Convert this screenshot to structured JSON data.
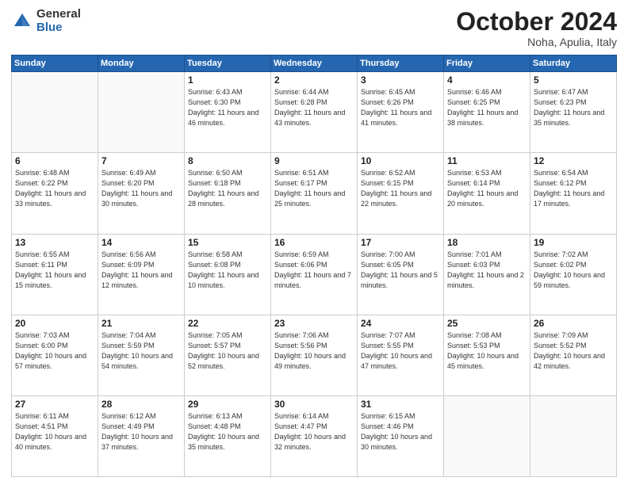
{
  "logo": {
    "general": "General",
    "blue": "Blue"
  },
  "header": {
    "month": "October 2024",
    "location": "Noha, Apulia, Italy"
  },
  "weekdays": [
    "Sunday",
    "Monday",
    "Tuesday",
    "Wednesday",
    "Thursday",
    "Friday",
    "Saturday"
  ],
  "weeks": [
    [
      {
        "day": null,
        "sunrise": "",
        "sunset": "",
        "daylight": ""
      },
      {
        "day": null,
        "sunrise": "",
        "sunset": "",
        "daylight": ""
      },
      {
        "day": "1",
        "sunrise": "Sunrise: 6:43 AM",
        "sunset": "Sunset: 6:30 PM",
        "daylight": "Daylight: 11 hours and 46 minutes."
      },
      {
        "day": "2",
        "sunrise": "Sunrise: 6:44 AM",
        "sunset": "Sunset: 6:28 PM",
        "daylight": "Daylight: 11 hours and 43 minutes."
      },
      {
        "day": "3",
        "sunrise": "Sunrise: 6:45 AM",
        "sunset": "Sunset: 6:26 PM",
        "daylight": "Daylight: 11 hours and 41 minutes."
      },
      {
        "day": "4",
        "sunrise": "Sunrise: 6:46 AM",
        "sunset": "Sunset: 6:25 PM",
        "daylight": "Daylight: 11 hours and 38 minutes."
      },
      {
        "day": "5",
        "sunrise": "Sunrise: 6:47 AM",
        "sunset": "Sunset: 6:23 PM",
        "daylight": "Daylight: 11 hours and 35 minutes."
      }
    ],
    [
      {
        "day": "6",
        "sunrise": "Sunrise: 6:48 AM",
        "sunset": "Sunset: 6:22 PM",
        "daylight": "Daylight: 11 hours and 33 minutes."
      },
      {
        "day": "7",
        "sunrise": "Sunrise: 6:49 AM",
        "sunset": "Sunset: 6:20 PM",
        "daylight": "Daylight: 11 hours and 30 minutes."
      },
      {
        "day": "8",
        "sunrise": "Sunrise: 6:50 AM",
        "sunset": "Sunset: 6:18 PM",
        "daylight": "Daylight: 11 hours and 28 minutes."
      },
      {
        "day": "9",
        "sunrise": "Sunrise: 6:51 AM",
        "sunset": "Sunset: 6:17 PM",
        "daylight": "Daylight: 11 hours and 25 minutes."
      },
      {
        "day": "10",
        "sunrise": "Sunrise: 6:52 AM",
        "sunset": "Sunset: 6:15 PM",
        "daylight": "Daylight: 11 hours and 22 minutes."
      },
      {
        "day": "11",
        "sunrise": "Sunrise: 6:53 AM",
        "sunset": "Sunset: 6:14 PM",
        "daylight": "Daylight: 11 hours and 20 minutes."
      },
      {
        "day": "12",
        "sunrise": "Sunrise: 6:54 AM",
        "sunset": "Sunset: 6:12 PM",
        "daylight": "Daylight: 11 hours and 17 minutes."
      }
    ],
    [
      {
        "day": "13",
        "sunrise": "Sunrise: 6:55 AM",
        "sunset": "Sunset: 6:11 PM",
        "daylight": "Daylight: 11 hours and 15 minutes."
      },
      {
        "day": "14",
        "sunrise": "Sunrise: 6:56 AM",
        "sunset": "Sunset: 6:09 PM",
        "daylight": "Daylight: 11 hours and 12 minutes."
      },
      {
        "day": "15",
        "sunrise": "Sunrise: 6:58 AM",
        "sunset": "Sunset: 6:08 PM",
        "daylight": "Daylight: 11 hours and 10 minutes."
      },
      {
        "day": "16",
        "sunrise": "Sunrise: 6:59 AM",
        "sunset": "Sunset: 6:06 PM",
        "daylight": "Daylight: 11 hours and 7 minutes."
      },
      {
        "day": "17",
        "sunrise": "Sunrise: 7:00 AM",
        "sunset": "Sunset: 6:05 PM",
        "daylight": "Daylight: 11 hours and 5 minutes."
      },
      {
        "day": "18",
        "sunrise": "Sunrise: 7:01 AM",
        "sunset": "Sunset: 6:03 PM",
        "daylight": "Daylight: 11 hours and 2 minutes."
      },
      {
        "day": "19",
        "sunrise": "Sunrise: 7:02 AM",
        "sunset": "Sunset: 6:02 PM",
        "daylight": "Daylight: 10 hours and 59 minutes."
      }
    ],
    [
      {
        "day": "20",
        "sunrise": "Sunrise: 7:03 AM",
        "sunset": "Sunset: 6:00 PM",
        "daylight": "Daylight: 10 hours and 57 minutes."
      },
      {
        "day": "21",
        "sunrise": "Sunrise: 7:04 AM",
        "sunset": "Sunset: 5:59 PM",
        "daylight": "Daylight: 10 hours and 54 minutes."
      },
      {
        "day": "22",
        "sunrise": "Sunrise: 7:05 AM",
        "sunset": "Sunset: 5:57 PM",
        "daylight": "Daylight: 10 hours and 52 minutes."
      },
      {
        "day": "23",
        "sunrise": "Sunrise: 7:06 AM",
        "sunset": "Sunset: 5:56 PM",
        "daylight": "Daylight: 10 hours and 49 minutes."
      },
      {
        "day": "24",
        "sunrise": "Sunrise: 7:07 AM",
        "sunset": "Sunset: 5:55 PM",
        "daylight": "Daylight: 10 hours and 47 minutes."
      },
      {
        "day": "25",
        "sunrise": "Sunrise: 7:08 AM",
        "sunset": "Sunset: 5:53 PM",
        "daylight": "Daylight: 10 hours and 45 minutes."
      },
      {
        "day": "26",
        "sunrise": "Sunrise: 7:09 AM",
        "sunset": "Sunset: 5:52 PM",
        "daylight": "Daylight: 10 hours and 42 minutes."
      }
    ],
    [
      {
        "day": "27",
        "sunrise": "Sunrise: 6:11 AM",
        "sunset": "Sunset: 4:51 PM",
        "daylight": "Daylight: 10 hours and 40 minutes."
      },
      {
        "day": "28",
        "sunrise": "Sunrise: 6:12 AM",
        "sunset": "Sunset: 4:49 PM",
        "daylight": "Daylight: 10 hours and 37 minutes."
      },
      {
        "day": "29",
        "sunrise": "Sunrise: 6:13 AM",
        "sunset": "Sunset: 4:48 PM",
        "daylight": "Daylight: 10 hours and 35 minutes."
      },
      {
        "day": "30",
        "sunrise": "Sunrise: 6:14 AM",
        "sunset": "Sunset: 4:47 PM",
        "daylight": "Daylight: 10 hours and 32 minutes."
      },
      {
        "day": "31",
        "sunrise": "Sunrise: 6:15 AM",
        "sunset": "Sunset: 4:46 PM",
        "daylight": "Daylight: 10 hours and 30 minutes."
      },
      {
        "day": null,
        "sunrise": "",
        "sunset": "",
        "daylight": ""
      },
      {
        "day": null,
        "sunrise": "",
        "sunset": "",
        "daylight": ""
      }
    ]
  ]
}
